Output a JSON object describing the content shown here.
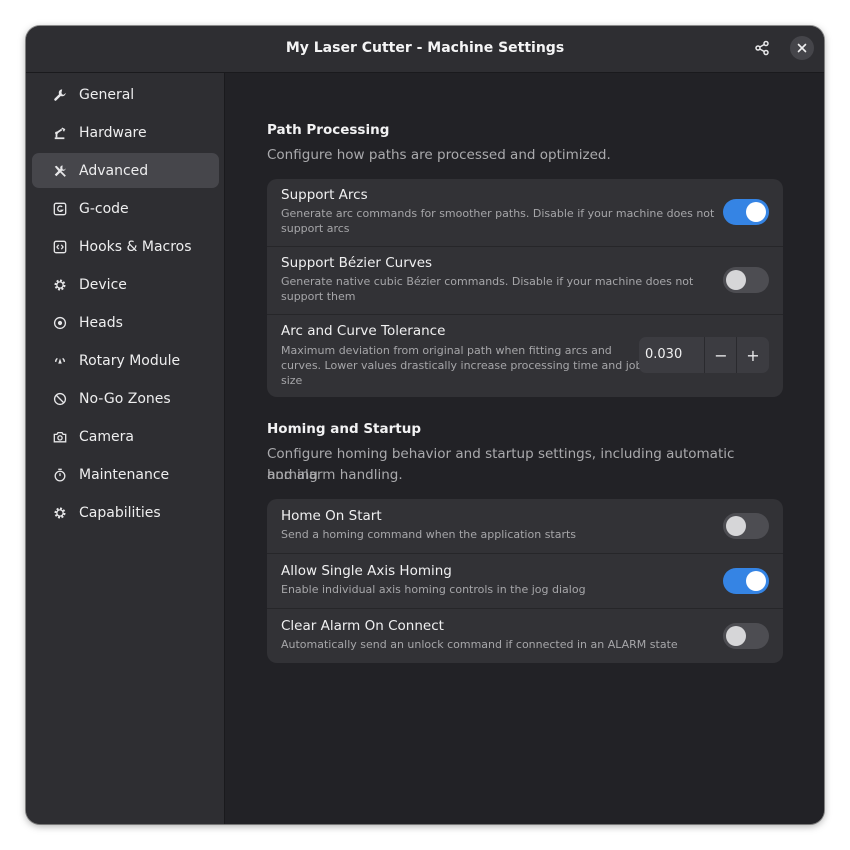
{
  "window": {
    "title": "My Laser Cutter - Machine Settings",
    "accent_color": "#3584e4",
    "share_icon": "share-icon",
    "close_icon": "close-icon"
  },
  "sidebar": {
    "items": [
      {
        "label": "General",
        "icon": "wrench-icon",
        "active": false
      },
      {
        "label": "Hardware",
        "icon": "robot-arm-icon",
        "active": false
      },
      {
        "label": "Advanced",
        "icon": "tools-icon",
        "active": true
      },
      {
        "label": "G-code",
        "icon": "gcode-icon",
        "active": false
      },
      {
        "label": "Hooks & Macros",
        "icon": "code-icon",
        "active": false
      },
      {
        "label": "Device",
        "icon": "gear-icon",
        "active": false
      },
      {
        "label": "Heads",
        "icon": "target-icon",
        "active": false
      },
      {
        "label": "Rotary Module",
        "icon": "rotate-icon",
        "active": false
      },
      {
        "label": "No-Go Zones",
        "icon": "no-entry-icon",
        "active": false
      },
      {
        "label": "Camera",
        "icon": "camera-icon",
        "active": false
      },
      {
        "label": "Maintenance",
        "icon": "stopwatch-icon",
        "active": false
      },
      {
        "label": "Capabilities",
        "icon": "gear-icon",
        "active": false
      }
    ]
  },
  "path_processing": {
    "title": "Path Processing",
    "description": "Configure how paths are processed and optimized.",
    "rows": [
      {
        "title": "Support Arcs",
        "subtitle_line1": "Generate arc commands for smoother paths. Disable if your machine does not",
        "subtitle_line2": "support arcs",
        "enabled": true
      },
      {
        "title": "Support Bézier Curves",
        "subtitle_line1": "Generate native cubic Bézier commands. Disable if your machine does not",
        "subtitle_line2": "support them",
        "enabled": false
      }
    ],
    "tolerance": {
      "title": "Arc and Curve Tolerance",
      "subtitle_line1": "Maximum deviation from original path when fitting arcs and",
      "subtitle_line2": "curves. Lower values drastically increase processing time and job",
      "subtitle_line3": "size",
      "value": "0.030",
      "minus": "−",
      "plus": "+"
    }
  },
  "homing": {
    "title": "Homing and Startup",
    "description_line1": "Configure homing behavior and startup settings, including automatic homing",
    "description_line2": "and alarm handling.",
    "rows": [
      {
        "title": "Home On Start",
        "subtitle": "Send a homing command when the application starts",
        "enabled": false
      },
      {
        "title": "Allow Single Axis Homing",
        "subtitle": "Enable individual axis homing controls in the jog dialog",
        "enabled": true
      },
      {
        "title": "Clear Alarm On Connect",
        "subtitle": "Automatically send an unlock command if connected in an ALARM state",
        "enabled": false
      }
    ]
  }
}
